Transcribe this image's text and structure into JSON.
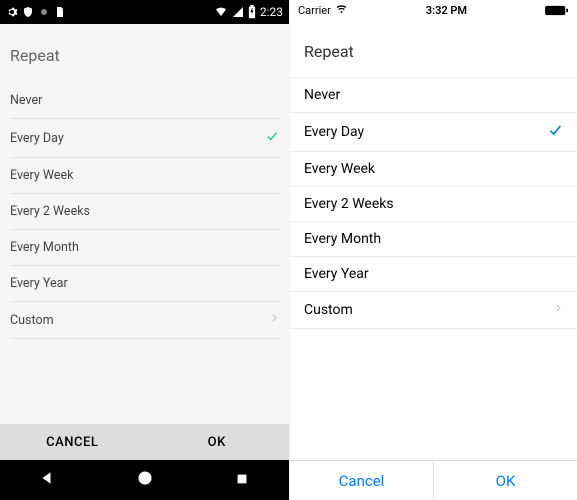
{
  "android": {
    "status": {
      "time": "2:23"
    },
    "heading": "Repeat",
    "options": [
      {
        "label": "Never",
        "selected": false,
        "disclosure": false
      },
      {
        "label": "Every Day",
        "selected": true,
        "disclosure": false
      },
      {
        "label": "Every Week",
        "selected": false,
        "disclosure": false
      },
      {
        "label": "Every 2 Weeks",
        "selected": false,
        "disclosure": false
      },
      {
        "label": "Every Month",
        "selected": false,
        "disclosure": false
      },
      {
        "label": "Every Year",
        "selected": false,
        "disclosure": false
      },
      {
        "label": "Custom",
        "selected": false,
        "disclosure": true
      }
    ],
    "actions": {
      "cancel": "CANCEL",
      "ok": "OK"
    }
  },
  "ios": {
    "status": {
      "carrier": "Carrier",
      "time": "3:32 PM"
    },
    "heading": "Repeat",
    "options": [
      {
        "label": "Never",
        "selected": false,
        "disclosure": false
      },
      {
        "label": "Every Day",
        "selected": true,
        "disclosure": false
      },
      {
        "label": "Every Week",
        "selected": false,
        "disclosure": false
      },
      {
        "label": "Every 2 Weeks",
        "selected": false,
        "disclosure": false
      },
      {
        "label": "Every Month",
        "selected": false,
        "disclosure": false
      },
      {
        "label": "Every Year",
        "selected": false,
        "disclosure": false
      },
      {
        "label": "Custom",
        "selected": false,
        "disclosure": true
      }
    ],
    "actions": {
      "cancel": "Cancel",
      "ok": "OK"
    }
  }
}
